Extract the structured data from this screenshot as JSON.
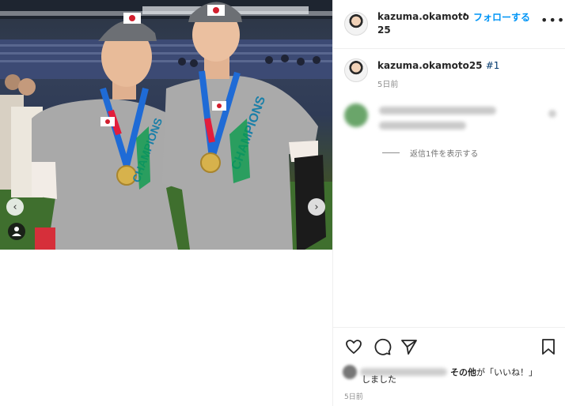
{
  "header": {
    "username": "kazuma.okamoto25",
    "separator": "•",
    "follow_label": "フォローする",
    "more_icon": "more-options-icon",
    "more_label": "•••"
  },
  "caption": {
    "username": "kazuma.okamoto25",
    "hashtag": "#1",
    "time": "5日前"
  },
  "comment": {
    "replies_label": "返信1件を表示する"
  },
  "photo": {
    "prev_label": "‹",
    "next_label": "›",
    "shirt_text": "CHAMPIONS",
    "accent_colors": [
      "#e21e3c",
      "#f7d117",
      "#0a9b4c",
      "#1f6bd6"
    ]
  },
  "actions": {
    "like_icon": "heart-icon",
    "comment_icon": "comment-icon",
    "share_icon": "share-icon",
    "save_icon": "bookmark-icon"
  },
  "likes": {
    "text_bold": "その他",
    "text_rest": "が「いいね！」",
    "line2": "しました"
  },
  "post_time": "5日前"
}
